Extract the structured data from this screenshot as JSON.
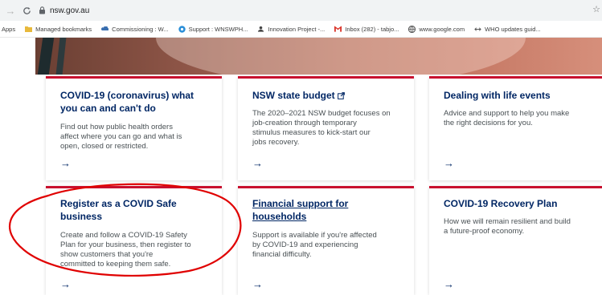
{
  "browser": {
    "url": "nsw.gov.au",
    "bookmarks": [
      {
        "label": "Apps",
        "icon": "apps-grid-icon"
      },
      {
        "label": "Managed bookmarks",
        "icon": "folder-icon",
        "color": "#e8b93c"
      },
      {
        "label": "Commissioning : W...",
        "icon": "cloud-icon",
        "color": "#3a6fb0"
      },
      {
        "label": "Support : WNSWPH...",
        "icon": "support-icon",
        "color": "#2b8fd8"
      },
      {
        "label": "Innovation Project -...",
        "icon": "team-icon",
        "color": "#444444"
      },
      {
        "label": "Inbox (282) - tabjo...",
        "icon": "gmail-icon",
        "color": "#d93025"
      },
      {
        "label": "www.google.com",
        "icon": "globe-icon",
        "color": "#555555"
      },
      {
        "label": "WHO updates guid...",
        "icon": "who-icon",
        "color": "#555555"
      }
    ]
  },
  "cards": [
    {
      "title_line1": "COVID-19 (coronavirus) what",
      "title_line2": "you can and can't do",
      "desc_lines": [
        "Find out how public health orders",
        "affect where you can go and what is",
        "open, closed or restricted."
      ],
      "arrow": "→"
    },
    {
      "title_line1": "NSW state budget",
      "title_line2": "",
      "desc_lines": [
        "The 2020–2021 NSW budget focuses on",
        "job-creation through temporary",
        "stimulus measures to kick-start our",
        "jobs recovery."
      ],
      "arrow": "→"
    },
    {
      "title_line1": "Dealing with life events",
      "title_line2": "",
      "desc_lines": [
        "Advice and support to help you make",
        "the right decisions for you."
      ],
      "arrow": "→"
    },
    {
      "title_line1": "Register as a COVID Safe",
      "title_line2": "business",
      "desc_lines": [
        "Create and follow a COVID-19 Safety",
        "Plan for your business, then register to",
        "show customers that you're",
        "committed to keeping them safe."
      ],
      "arrow": "→"
    },
    {
      "title_line1": "Financial support for",
      "title_line2": "households",
      "desc_lines": [
        "Support is available if you're affected",
        "by COVID-19 and experiencing",
        "financial difficulty."
      ],
      "arrow": "→"
    },
    {
      "title_line1": "COVID-19 Recovery Plan",
      "title_line2": "",
      "desc_lines": [
        "How we will remain resilient and build",
        "a future-proof economy."
      ],
      "arrow": "→"
    }
  ],
  "colors": {
    "accent": "#c8102e",
    "title": "#002664",
    "annotation": "#e00000"
  }
}
